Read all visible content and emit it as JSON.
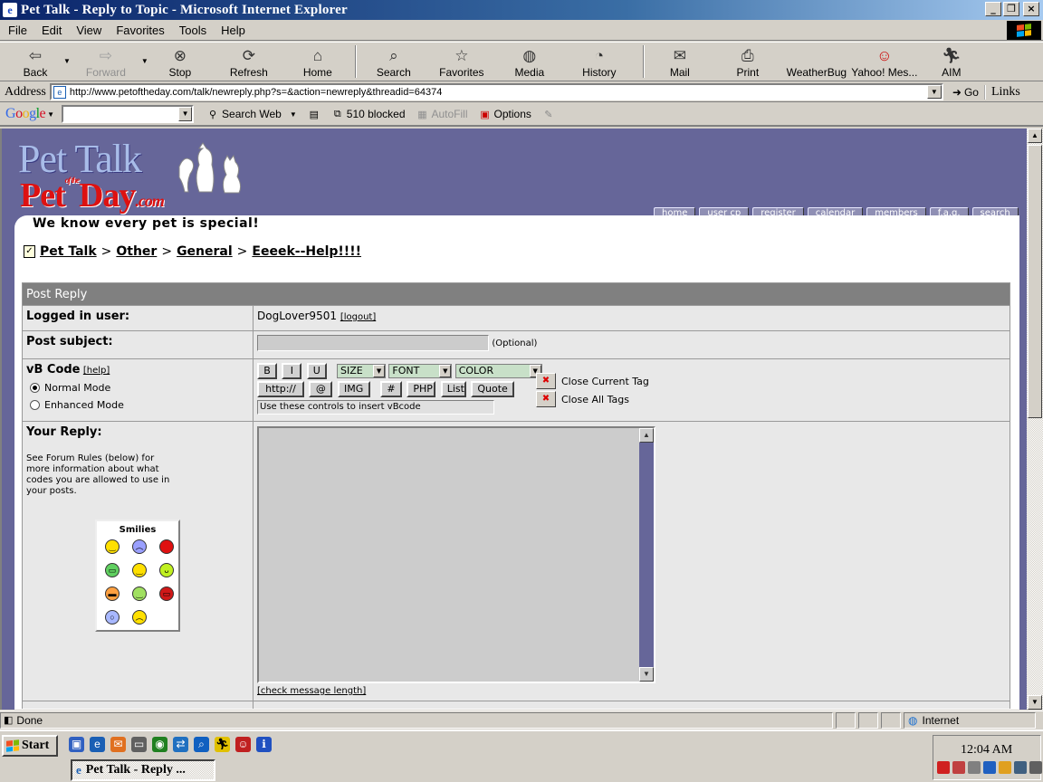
{
  "window": {
    "title": "Pet Talk - Reply to Topic - Microsoft Internet Explorer"
  },
  "menu": [
    "File",
    "Edit",
    "View",
    "Favorites",
    "Tools",
    "Help"
  ],
  "toolbar": {
    "back": "Back",
    "forward": "Forward",
    "stop": "Stop",
    "refresh": "Refresh",
    "home": "Home",
    "search": "Search",
    "favorites": "Favorites",
    "media": "Media",
    "history": "History",
    "mail": "Mail",
    "print": "Print",
    "weatherbug": "WeatherBug",
    "yahoo": "Yahoo! Mes...",
    "aim": "AIM"
  },
  "address": {
    "label": "Address",
    "url": "http://www.petoftheday.com/talk/newreply.php?s=&action=newreply&threadid=64374",
    "go": "Go",
    "links": "Links"
  },
  "googlebar": {
    "logo": "Google",
    "search_web": "Search Web",
    "blocked": "510 blocked",
    "autofill": "AutoFill",
    "options": "Options"
  },
  "site": {
    "logo_title": "Pet Talk",
    "logo_sub": "Pet",
    "logo_of_the": "of the",
    "logo_day": "Day",
    "logo_com": ".com",
    "tagline": "We know every pet is special!",
    "nav": [
      "home",
      "user cp",
      "register",
      "calendar",
      "members",
      "f.a.q.",
      "search"
    ]
  },
  "breadcrumb": [
    "Pet Talk",
    "Other",
    "General",
    "Eeeek--Help!!!!"
  ],
  "form": {
    "header": "Post Reply",
    "logged_in_label": "Logged in user:",
    "username": "DogLover9501",
    "logout": "[logout]",
    "subject_label": "Post subject:",
    "subject_optional": "(Optional)",
    "vbcode_label": "vB Code",
    "vbcode_help": "[help]",
    "normal_mode": "Normal Mode",
    "enhanced_mode": "Enhanced Mode",
    "buttons_row1": [
      "B",
      "I",
      "U"
    ],
    "size": "SIZE",
    "font": "FONT",
    "color": "COLOR",
    "buttons_row2": [
      "http://",
      "@",
      "IMG",
      "#",
      "PHP",
      "List",
      "Quote"
    ],
    "vb_hint": "Use these controls to insert vBcode",
    "close_current": "Close Current Tag",
    "close_all": "Close All Tags",
    "reply_label": "Your Reply:",
    "reply_help": "See Forum Rules (below) for more information about what codes you are allowed to use in your posts.",
    "smilies_title": "Smilies",
    "check_length": "[check message length]"
  },
  "status": {
    "text": "Done",
    "zone": "Internet"
  },
  "taskbar": {
    "start": "Start",
    "task": "Pet Talk - Reply ...",
    "clock": "12:04 AM"
  }
}
